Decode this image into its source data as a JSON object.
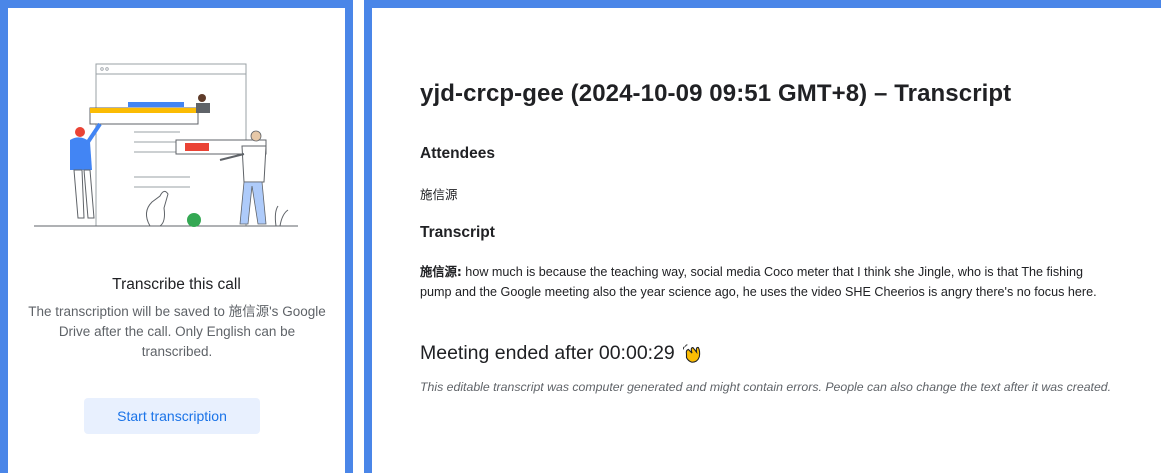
{
  "left_panel": {
    "heading": "Transcribe this call",
    "description": "The transcription will be saved to 施信源's Google Drive after the call. Only English can be transcribed.",
    "button_label": "Start transcription",
    "illustration": "transcription-illustration"
  },
  "document": {
    "title": "yjd-crcp-gee (2024-10-09 09:51 GMT+8) – Transcript",
    "attendees_heading": "Attendees",
    "attendees": [
      "施信源"
    ],
    "transcript_heading": "Transcript",
    "speaker": "施信源:",
    "transcript_text": " how much is because the teaching way, social media Coco meter that I think she Jingle, who is that The fishing pump and the Google meeting also the year science ago, he uses the video SHE Cheerios is angry there's no focus here.",
    "meeting_ended": "Meeting ended after 00:00:29",
    "meeting_ended_icon": "waving-hand-icon",
    "disclaimer": "This editable transcript was computer generated and might contain errors. People can also change the text after it was created."
  },
  "colors": {
    "frame": "#4a86e8",
    "button_bg": "#e8f0fe",
    "button_text": "#1a73e8",
    "muted_text": "#5f6368"
  }
}
